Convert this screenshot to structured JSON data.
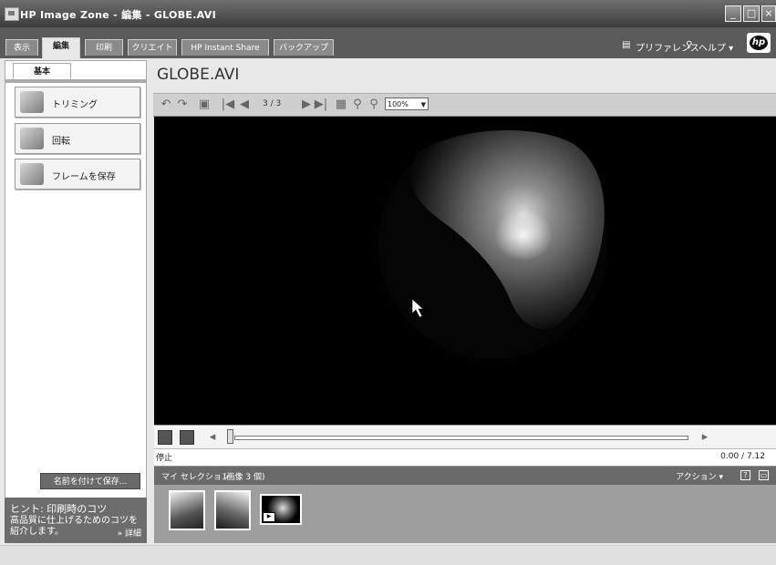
{
  "window": {
    "title": "HP Image Zone - 編集 - GLOBE.AVI",
    "minimize": "_",
    "maximize": "□",
    "close": "×"
  },
  "tabs": [
    {
      "label": "表示",
      "active": false
    },
    {
      "label": "編集",
      "active": true
    },
    {
      "label": "印刷",
      "active": false
    },
    {
      "label": "クリエイト",
      "active": false
    },
    {
      "label": "HP Instant Share",
      "active": false
    },
    {
      "label": "バックアップ",
      "active": false
    }
  ],
  "header_right": {
    "preferences": "プリファレンス",
    "help": "ヘルプ ▾",
    "logo_text": "hp"
  },
  "left_panel": {
    "tab_label": "基本",
    "tools": [
      {
        "label": "トリミング",
        "icon": "trim-icon"
      },
      {
        "label": "回転",
        "icon": "rotate-icon"
      },
      {
        "label": "フレームを保存",
        "icon": "save-frame-icon"
      }
    ],
    "save_as_button": "名前を付けて保存..."
  },
  "hint": {
    "title": "ヒント: 印刷時のコツ",
    "body": "高品質に仕上げるためのコツを紹介します。",
    "more": "» 詳細"
  },
  "main": {
    "file_name": "GLOBE.AVI",
    "page_indicator": "3 / 3",
    "zoom": "100%",
    "status_text": "停止",
    "time": "0.00 / 7.12",
    "playback_progress": 0.0
  },
  "selection": {
    "title": "マイ セレクション",
    "count": "(画像 3 個)",
    "actions": "アクション ▾",
    "thumbnails": [
      {
        "kind": "image"
      },
      {
        "kind": "image"
      },
      {
        "kind": "video"
      }
    ]
  },
  "colors": {
    "titlebar": "#4a4a4a",
    "tab_bar": "#5a5a5a",
    "video_bg": "#000000"
  }
}
